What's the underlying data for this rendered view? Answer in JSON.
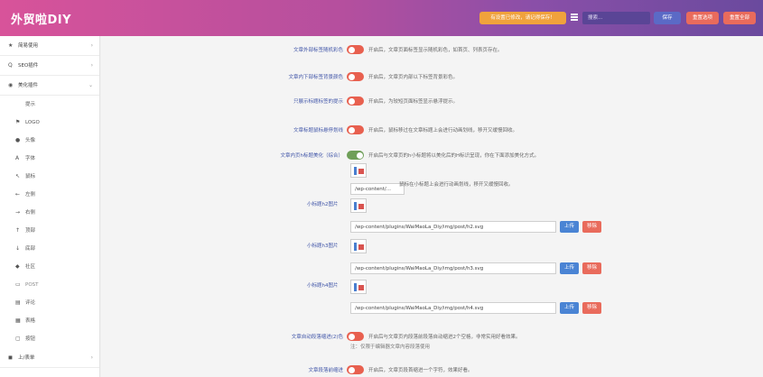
{
  "header": {
    "title": "外贸啦DIY",
    "notice": "有设置已修改，请记得保存！",
    "search_placeholder": "搜索...",
    "save_label": "保存",
    "reset_option_label": "重置选项",
    "reset_all_label": "重置全部"
  },
  "sidebar": {
    "items": [
      {
        "label": "简易使用",
        "icon": "★",
        "kind": "group"
      },
      {
        "label": "SEO插件",
        "icon": "Q",
        "kind": "group"
      },
      {
        "label": "美化插件",
        "icon": "◉",
        "kind": "group"
      },
      {
        "label": "提示",
        "icon": "",
        "kind": "sub"
      },
      {
        "label": "LOGO",
        "icon": "⚑",
        "kind": "sub"
      },
      {
        "label": "头像",
        "icon": "●",
        "kind": "sub"
      },
      {
        "label": "字体",
        "icon": "A",
        "kind": "sub"
      },
      {
        "label": "鼠标",
        "icon": "↖",
        "kind": "sub"
      },
      {
        "label": "左侧",
        "icon": "←",
        "kind": "sub"
      },
      {
        "label": "右侧",
        "icon": "→",
        "kind": "sub"
      },
      {
        "label": "顶部",
        "icon": "↑",
        "kind": "sub"
      },
      {
        "label": "底部",
        "icon": "↓",
        "kind": "sub"
      },
      {
        "label": "社区",
        "icon": "◆",
        "kind": "sub"
      },
      {
        "label": "POST",
        "icon": "▭",
        "kind": "sub"
      },
      {
        "label": "评论",
        "icon": "▤",
        "kind": "sub"
      },
      {
        "label": "表格",
        "icon": "▦",
        "kind": "sub"
      },
      {
        "label": "按钮",
        "icon": "▢",
        "kind": "sub"
      },
      {
        "label": "上/表单",
        "icon": "◼",
        "kind": "group"
      }
    ]
  },
  "main": {
    "rows": [
      {
        "label": "文章外部标签随机彩色",
        "desc": "开启后，文章页面标签显示随机彩色，如首页、列表页存在。"
      },
      {
        "label": "文章内下部标签背景颜色",
        "desc": "开启后，文章页内部以下标签背景彩色。"
      },
      {
        "label": "只展示标题标签的提示",
        "desc": "开启后，为较短页面标签显示悬浮提示。"
      },
      {
        "label": "文章标题鼠标悬停划线",
        "desc": "开启后，鼠标移过在文章标题上会进行动画划线，移开又缓慢回收。"
      },
      {
        "label": "文章内页h标题美化（综合）",
        "desc": "开启后与文章页的h小标题将以美化后的H标识呈现，你在下面添加美化方式。"
      }
    ],
    "h_section": {
      "desc2": "鼠标在小标题上会进行动画划线，移开又缓慢回收。",
      "h1_path": "/wp-content/...",
      "h2_label": "小标题h2图片",
      "h2_path": "/wp-content/plugins/WaiMaoLa_Diy/img/post/h2.svg",
      "h3_label": "小标题h3图片",
      "h3_path": "/wp-content/plugins/WaiMaoLa_Diy/img/post/h3.svg",
      "h4_label": "小标题h4图片",
      "h4_path": "/wp-content/plugins/WaiMaoLa_Diy/img/post/h4.svg",
      "upload_label": "上传",
      "remove_label": "移除"
    },
    "bottom_rows": [
      {
        "label": "文章自动段落缩进(2)色",
        "desc": "开启后与文章页内段落前段落自动缩进2个空格，非常实用好看效果。",
        "note": "注：仅限于编辑器文章内容段落使用"
      },
      {
        "label": "文章段落前缩进",
        "desc": "开启后，文章页段首缩进一个字符，效果好看。"
      }
    ]
  },
  "colors": {
    "header_start": "#d8539a",
    "header_end": "#6a4a9e",
    "toggle_off": "#e8604f",
    "toggle_on": "#6f9f58",
    "label_blue": "#4055a8",
    "upload_blue": "#4a84d4",
    "remove_red": "#e96b5c",
    "notice_orange": "#f0a23c"
  }
}
